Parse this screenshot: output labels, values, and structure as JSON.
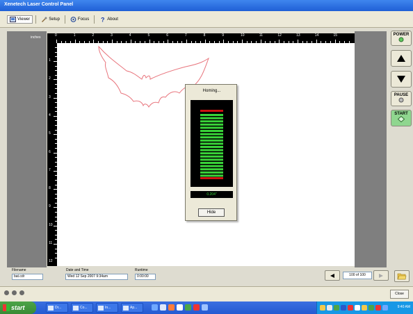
{
  "window": {
    "title": "Xenetech Laser Control Panel"
  },
  "tabs": [
    {
      "label": "Viewer",
      "icon": "viewer-icon",
      "active": true
    },
    {
      "label": "Setup",
      "icon": "setup-icon",
      "active": false
    },
    {
      "label": "Focus",
      "icon": "focus-icon",
      "active": false
    },
    {
      "label": "About",
      "icon": "help-icon",
      "active": false
    }
  ],
  "ruler": {
    "units": "inches",
    "top_numbers": [
      "0",
      "1",
      "2",
      "3",
      "4",
      "5",
      "6",
      "7",
      "8",
      "9",
      "10",
      "11",
      "12",
      "13",
      "14",
      "15"
    ],
    "left_numbers": [
      "1",
      "2",
      "3",
      "4",
      "5",
      "6",
      "7",
      "8",
      "9",
      "10",
      "11",
      "12"
    ]
  },
  "controls": {
    "power_label": "POWER",
    "pause_label": "PAUSE",
    "start_label": "START",
    "up_arrow": "up-arrow-icon",
    "down_arrow": "down-arrow-icon"
  },
  "dialog": {
    "title": "Homing...",
    "value": "0.204\"",
    "hide_label": "Hide",
    "meter_color": "#39d439",
    "meter_limit_color": "#cc1111"
  },
  "status": {
    "filename_label": "Filename",
    "filename_value": "bat.cdr",
    "datetime_label": "Date and Time",
    "datetime_value": "Wed 12 Sep 2007  9:34am",
    "runtime_label": "Runtime",
    "runtime_value": "0:00:00"
  },
  "pager": {
    "value": "100 of 100"
  },
  "bottom": {
    "close_label": "Close"
  },
  "taskbar": {
    "start_label": "start",
    "tasks": [
      "Dr...",
      "Co...",
      "In...",
      "Ap..."
    ],
    "clock": "9:40 AM"
  },
  "colors": {
    "artwork_stroke": "#e8747c",
    "accent_green": "#5fc75f"
  }
}
